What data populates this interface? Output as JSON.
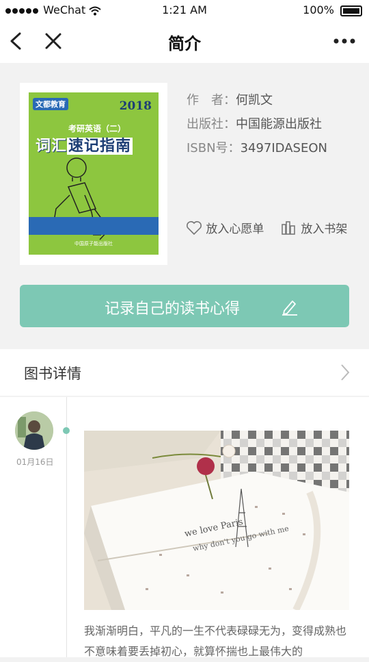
{
  "status_bar": {
    "carrier": "WeChat",
    "time": "1:21 AM",
    "battery": "100%"
  },
  "nav": {
    "title": "简介"
  },
  "book": {
    "author_label": "作　者：",
    "author": "何凯文",
    "publisher_label": "出版社：",
    "publisher": "中国能源出版社",
    "isbn_label": "ISBN号：",
    "isbn": "3497IDASEON",
    "cover": {
      "brand": "文都教育",
      "year": "2018",
      "subtitle": "考研英语（二）",
      "title_part1": "词汇",
      "title_highlight": "速记指南",
      "publisher_line": "中国原子能出版社"
    }
  },
  "actions": {
    "wishlist": "放入心愿单",
    "bookshelf": "放入书架"
  },
  "note_button": {
    "label": "记录自己的读书心得"
  },
  "details": {
    "label": "图书详情"
  },
  "timeline": {
    "date": "01月16日",
    "excerpt": "我渐渐明白，平凡的一生不代表碌碌无为，变得成熟也不意味着要丢掉初心，就算怀揣也上最伟大的"
  },
  "icons": {
    "back": "chevron-left-icon",
    "close": "close-icon",
    "more": "more-icon",
    "wishlist": "heart-icon",
    "bookshelf": "bookshelf-icon",
    "edit": "pencil-icon",
    "arrow": "chevron-right-icon"
  },
  "colors": {
    "accent": "#7dc8b4",
    "cover_green": "#8dc63f",
    "cover_blue": "#2a6ab5"
  }
}
